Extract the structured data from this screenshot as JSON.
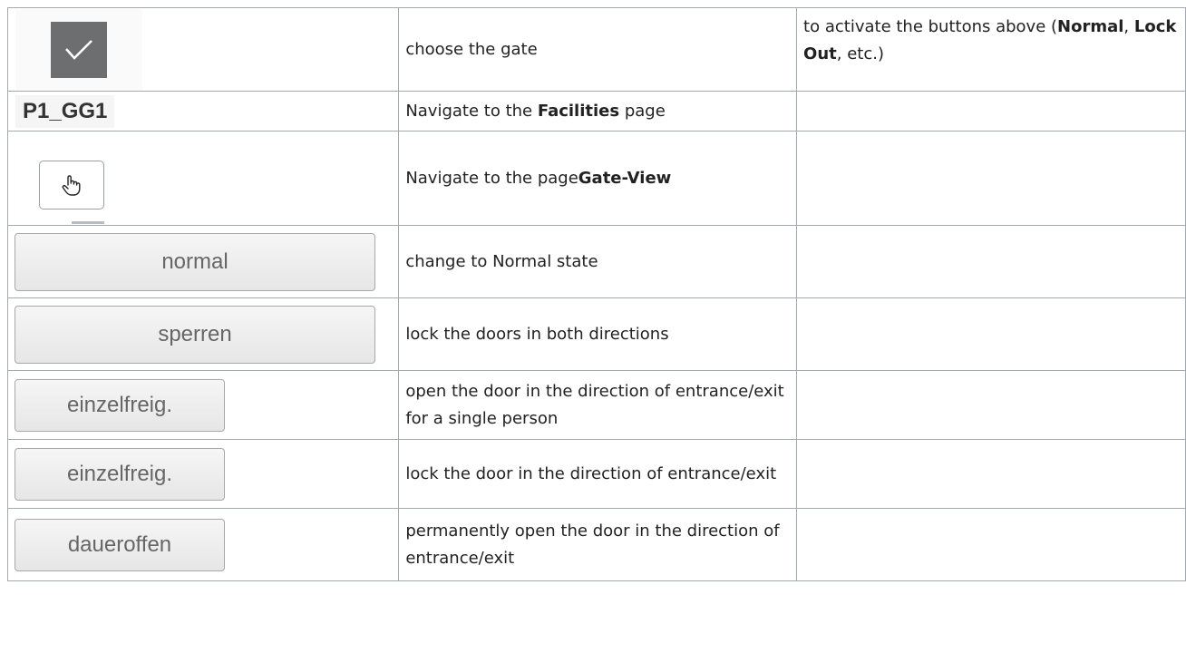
{
  "rows": [
    {
      "icon": "checkmark-icon",
      "desc": "choose the gate",
      "note_parts": [
        "to activate the buttons above (",
        "Normal",
        ", ",
        "Lock Out",
        ", etc.)"
      ]
    },
    {
      "gate_label": "P1_GG1",
      "desc_pre": "Navigate to the ",
      "desc_bold": "Facilities",
      "desc_post": " page"
    },
    {
      "icon": "hand-pointer-icon",
      "desc_pre": "Navigate to the page",
      "desc_bold": "Gate-View"
    },
    {
      "button": "normal",
      "desc": "change to Normal state"
    },
    {
      "button": "sperren",
      "desc": "lock the doors in both directions"
    },
    {
      "button": "einzelfreig.",
      "desc": "open the door in the direction of entrance/exit for a single person"
    },
    {
      "button": "einzelfreig.",
      "desc": "lock the door in the direction of entrance/exit"
    },
    {
      "button": "daueroffen",
      "desc": "permanently open the door in the direction of entrance/exit"
    }
  ],
  "colors": {
    "checkbox_bg": "#6d6e70",
    "border": "#a2a9b1",
    "button_text": "#666666"
  }
}
